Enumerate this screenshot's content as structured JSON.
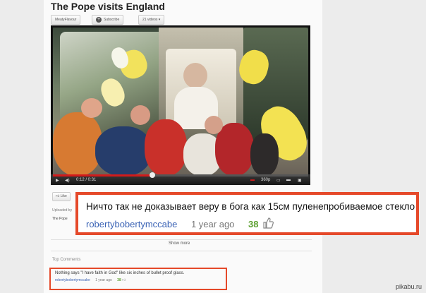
{
  "video": {
    "title": "The Pope visits England",
    "channel": "MeatyFlavour",
    "subscribe_label": "Subscribe",
    "videos_label": "21 videos",
    "time": "0:12 / 0:31",
    "quality": "360p",
    "progress": 0.39
  },
  "actions": {
    "like_label": "Like",
    "uploaded_by": "Uploaded by",
    "description_start": "The Pope"
  },
  "callout": {
    "text": "Ничто так не доказывает веру в бога как 15см пуленепробиваемое стекло",
    "user": "robertybobertymccabe",
    "age": "1 year ago",
    "votes": "38"
  },
  "comments": {
    "show_more": "Show more",
    "header": "Top Comments",
    "text": "Nothing says \"I have faith in God\" like six inches of bullet proof glass.",
    "user": "robertybobertymccabe",
    "age": "1 year ago",
    "votes": "38"
  },
  "watermark": "pikabu.ru",
  "colors": {
    "highlight": "#e5492a",
    "username": "#3b63b5",
    "votes": "#5b9f2f",
    "progress": "#d21b1b"
  }
}
